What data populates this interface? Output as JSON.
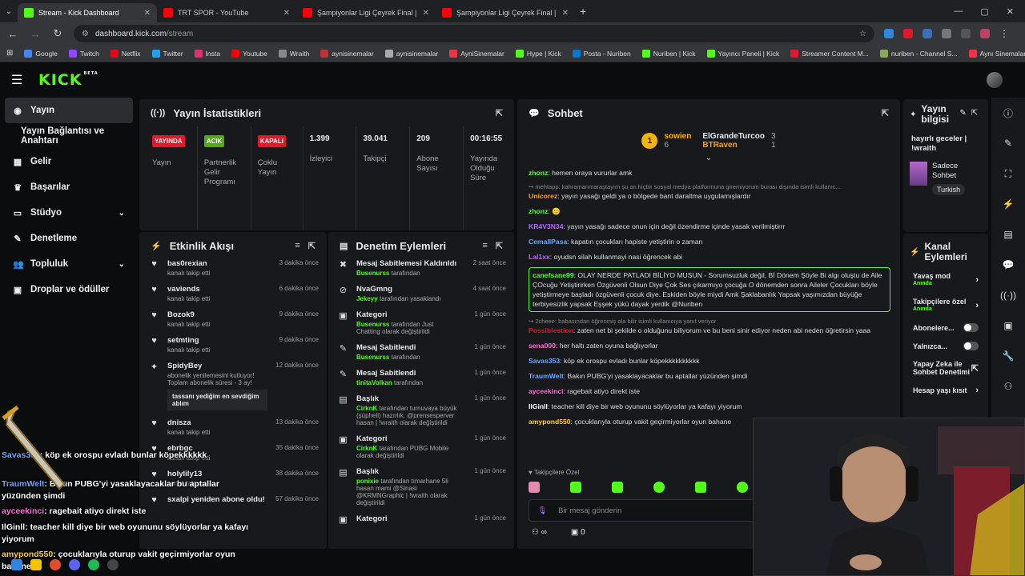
{
  "browser": {
    "tabs": [
      {
        "title": "Stream - Kick Dashboard",
        "color": "#53fc18",
        "active": true
      },
      {
        "title": "TRT SPOR - YouTube",
        "color": "#ff0000",
        "active": false
      },
      {
        "title": "Şampiyonlar Ligi Çeyrek Final |",
        "color": "#ff0000",
        "active": false
      },
      {
        "title": "Şampiyonlar Ligi Çeyrek Final |",
        "color": "#ff0000",
        "active": false
      }
    ],
    "url_host": "dashboard.kick.com",
    "url_path": "/stream",
    "bookmarks": [
      "Google",
      "Twitch",
      "Netflix",
      "Twitter",
      "Insta",
      "Youtube",
      "Wraith",
      "aynisinemalar",
      "aynisinemalar",
      "AyniSinemalar",
      "Hype | Kick",
      "Posta - Nuriben",
      "Nuriben | Kick",
      "Yayıncı Paneli | Kick",
      "Streamer Content M...",
      "nuriben - Channel S...",
      "Aynı Sinemalar - Ça..."
    ]
  },
  "sidebar": {
    "items": [
      {
        "label": "Yayın",
        "icon": "stream-icon",
        "glyph": "◉",
        "active": true
      },
      {
        "label": "Yayın Bağlantısı ve Anahtarı",
        "icon": "",
        "glyph": ""
      },
      {
        "label": "Gelir",
        "icon": "revenue-icon",
        "glyph": "▦"
      },
      {
        "label": "Başarılar",
        "icon": "trophy-icon",
        "glyph": "♛"
      },
      {
        "label": "Stüdyo",
        "icon": "studio-icon",
        "glyph": "▭",
        "chevron": "⌄"
      },
      {
        "label": "Denetleme",
        "icon": "wrench-icon",
        "glyph": "✎"
      },
      {
        "label": "Topluluk",
        "icon": "community-icon",
        "glyph": "👥",
        "chevron": "⌄"
      },
      {
        "label": "Droplar ve ödüller",
        "icon": "drops-icon",
        "glyph": "▣"
      }
    ]
  },
  "stats": {
    "title": "Yayın İstatistikleri",
    "cols": [
      {
        "badge": "YAYINDA",
        "badge_color": "#e3172b",
        "label": "Yayın"
      },
      {
        "badge": "ACIK",
        "badge_color": "#53a91a",
        "label": "Partnerlik Gelir Programı"
      },
      {
        "badge": "KAPALI",
        "badge_color": "#e3172b",
        "label": "Çoklu Yayın"
      },
      {
        "value": "1.399",
        "label": "İzleyici"
      },
      {
        "value": "39.041",
        "label": "Takipçi"
      },
      {
        "value": "209",
        "label": "Abone Sayısı"
      },
      {
        "value": "00:16:55",
        "label": "Yayında Olduğu Süre"
      }
    ]
  },
  "activity": {
    "title": "Etkinlik Akışı",
    "items": [
      {
        "name": "bas0rexian",
        "sub": "kanalı takip etti",
        "time": "3 dakika önce"
      },
      {
        "name": "vaviends",
        "sub": "kanalı takip etti",
        "time": "6 dakika önce"
      },
      {
        "name": "Bozok9",
        "sub": "kanalı takip etti",
        "time": "9 dakika önce"
      },
      {
        "name": "setmting",
        "sub": "kanalı takip etti",
        "time": "9 dakika önce"
      },
      {
        "name": "SpidyBey",
        "sub": "abonelik yenilemesini kutluyor! Toplam abonelik süresi - 3 ay!",
        "time": "12 dakika önce",
        "quote": "tassanı yediğim en sevdiğim ablım"
      },
      {
        "name": "dnisza",
        "sub": "kanalı takip etti",
        "time": "13 dakika önce"
      },
      {
        "name": "ebrbgc",
        "sub": "kanalı takip etti",
        "time": "35 dakika önce"
      },
      {
        "name": "holylily13",
        "sub": "kanalı takip etti",
        "time": "38 dakika önce"
      },
      {
        "name": "sxalpi yeniden abone oldu!",
        "sub": "",
        "time": "57 dakika önce"
      }
    ]
  },
  "moderation": {
    "title": "Denetim Eylemleri",
    "items": [
      {
        "action": "Mesaj Sabitlemesi Kaldırıldı",
        "who": "Busenurss",
        "rest": "tarafından",
        "time": "2 saat önce"
      },
      {
        "action": "NvaGmng",
        "who": "Jekeyy",
        "rest": "tarafından yasaklandı",
        "time": "4 saat önce"
      },
      {
        "action": "Kategori",
        "who": "Busenurss",
        "rest": "tarafından Just Chatting olarak değiştirildi",
        "time": "1 gün önce"
      },
      {
        "action": "Mesaj Sabitlendi",
        "who": "Busenurss",
        "rest": "tarafından",
        "time": "1 gün önce"
      },
      {
        "action": "Mesaj Sabitlendi",
        "who": "tinitaVolkan",
        "rest": "tarafından",
        "time": "1 gün önce"
      },
      {
        "action": "Başlık",
        "who": "CirknK",
        "rest": "tarafından turnuvaya büyük (şüpheli) hazırlık. @prensesperver hasan | !wraith olarak değiştirildi",
        "time": "1 gün önce"
      },
      {
        "action": "Kategori",
        "who": "CirknK",
        "rest": "tarafından PUBG Mobile olarak değiştirildi",
        "time": "1 gün önce"
      },
      {
        "action": "Başlık",
        "who": "ponixie",
        "rest": "tarafından tımarhane 5li hasan mami @Sinasi @KRMNGraphic | !wraith olarak değiştirildi",
        "time": "1 gün önce"
      },
      {
        "action": "Kategori",
        "who": "",
        "rest": "",
        "time": "1 gün önce"
      }
    ]
  },
  "chat": {
    "title": "Sohbet",
    "top1": {
      "name": "sowien",
      "count": "6"
    },
    "top2": {
      "name": "ElGrandeTurcoo",
      "count": "3"
    },
    "top3": {
      "name": "BTRaven",
      "count": "1"
    },
    "messages": [
      {
        "user": "zhonz",
        "color": "#53fc18",
        "text": ": hemen oraya vururlar amk"
      },
      {
        "reply": "↪ mehtapp: kahramanmaraştayım şu an hiçbir sosyal medya platformuna giremiyorum burası dışında isimli kullanıc..."
      },
      {
        "user": "Unicorez",
        "color": "#ff9e1b",
        "text": ": yayın yasağı geldi ya o bölgede bant daraltma uygulamışlardır"
      },
      {
        "user": "zhonz",
        "color": "#53fc18",
        "text": ": 🙂"
      },
      {
        "user": "KR4V3N34",
        "color": "#b86bff",
        "text": ": yayın yasağı sadece onun için değil özendirme içinde yasak verilmiştirrr"
      },
      {
        "user": "CemalIPasa",
        "color": "#6aa8ff",
        "text": ": kapatın çocukları hapiste yetiştirin o zaman"
      },
      {
        "user": "Lal1xx",
        "color": "#b86bff",
        "text": ": oyudsn silah kullanmayi nasi öğrencek abi"
      },
      {
        "user": "canefsane99",
        "color": "#53fc18",
        "text": ": OLAY NERDE PATLADI BİLİYO MUSUN - Sorumsuzluk değil, Bİ Dönem Şöyle Bi algı oluştu de Aile ÇOcuğu Yetiştirirken Özgüvenli Olsun Diye Çok Ses çıkarmıyo çocuğa O dönemden sonra Aileler Çocukları böyle yetiştirmeye başladı özgüvenli çocuk diye. Eskiden böyle miydi Amk Şaklabanlık Yapsak yaşımızdan büyüğe terbiyesizlik yapsak Eşşek yükü dayak yerdik @Nuriben",
        "highlight": true
      },
      {
        "reply": "↪ 2cheee: babasından öğrenmiş ola bilir isimli kullanıcıya yanıt veriyor"
      },
      {
        "user": "Possiblestion",
        "color": "#e3172b",
        "text": ": zaten net bi şekilde o olduğunu biliyorum ve bu beni sinir ediyor neden abi neden öğretirsin yaaa"
      },
      {
        "user": "sena000",
        "color": "#ff6bd6",
        "text": ": her haltı zaten oyuna bağlıyorlar"
      },
      {
        "user": "Savas353",
        "color": "#6aa8ff",
        "text": ": köp ek orospu evladı bunlar köpekkkkkkkkkk"
      },
      {
        "user": "TraumWelt",
        "color": "#6aa8ff",
        "text": ": Bakın PUBG'yi yasaklayacaklar bu aptallar yüzünden şimdi"
      },
      {
        "user": "ayceekinci",
        "color": "#ff6bd6",
        "text": ": ragebait atiyo direkt iste"
      },
      {
        "user": "IlGinll",
        "color": "#ffffff",
        "text": ": teacher kill diye bir web oyununu söylüyorlar ya kafayı yiyorum"
      },
      {
        "user": "amypond550",
        "color": "#ffd21b",
        "text": ": çocuklarıyla oturup vakit geçirmiyorlar oyun bahane"
      }
    ],
    "followers_only": "Takipçilere Özel",
    "placeholder": "Bir mesaj gönderin",
    "count_a": "0"
  },
  "stream_info": {
    "title": "Yayın bilgisi",
    "stream_title": "hayırlı geceler | !wraith",
    "category": "Sadece Sohbet",
    "tag": "Turkish"
  },
  "channel_actions": {
    "title": "Kanal Eylemleri",
    "items": [
      {
        "label": "Yavaş mod",
        "sub": "Anında",
        "kind": "chevron"
      },
      {
        "label": "Takipçilere özel",
        "sub": "Anında",
        "kind": "chevron"
      },
      {
        "label": "Abonelere...",
        "sub": "",
        "kind": "toggle"
      },
      {
        "label": "Yalnızca...",
        "sub": "",
        "kind": "toggle"
      },
      {
        "label": "Yapay Zeka ile Sohbet Denetimi",
        "sub": "",
        "kind": "link"
      },
      {
        "label": "Hesap yaşı kısıt",
        "sub": "",
        "kind": "chevron"
      }
    ]
  },
  "overlay_chat": [
    {
      "user": "Savas353",
      "color": "#6aa8ff",
      "text": ": köp ek orospu evladı bunlar köpekkkkkk"
    },
    {
      "user": "TraumWelt",
      "color": "#6aa8ff",
      "text": ": Bakın PUBG'yi yasaklayacaklar bu aptallar yüzünden şimdi"
    },
    {
      "user": "ayceekinci",
      "color": "#ff6bd6",
      "text": ": ragebait atiyo direkt iste"
    },
    {
      "user": "IlGinll",
      "color": "#ffffff",
      "text": ": teacher kill diye bir web oyununu söylüyorlar ya kafayı yiyorum"
    },
    {
      "user": "amypond550",
      "color": "#ffd21b",
      "text": ": çocuklarıyla oturup vakit geçirmiyorlar oyun bahane"
    }
  ]
}
